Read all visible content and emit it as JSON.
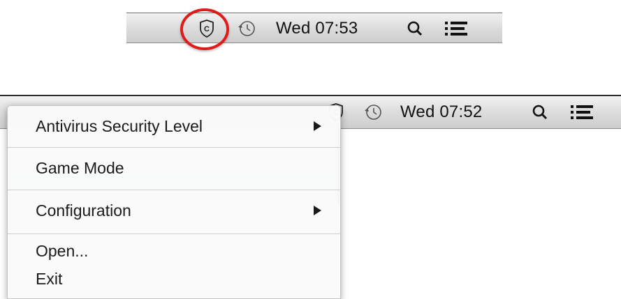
{
  "menubar_top": {
    "icons": [
      "comodo-shield-icon",
      "time-machine-icon",
      "spotlight-search-icon",
      "notification-list-icon"
    ],
    "clock": "Wed 07:53"
  },
  "menubar_bottom": {
    "icons": [
      "comodo-shield-icon",
      "time-machine-icon",
      "spotlight-search-icon",
      "notification-list-icon"
    ],
    "clock": "Wed 07:52"
  },
  "highlight_color": "#e01b1b",
  "menu": {
    "items": [
      {
        "label": "Antivirus Security Level",
        "has_submenu": true
      },
      {
        "label": "Game Mode",
        "has_submenu": false
      },
      {
        "label": "Configuration",
        "has_submenu": true
      },
      {
        "label": "Open...",
        "has_submenu": false
      },
      {
        "label": "Exit",
        "has_submenu": false
      }
    ]
  }
}
